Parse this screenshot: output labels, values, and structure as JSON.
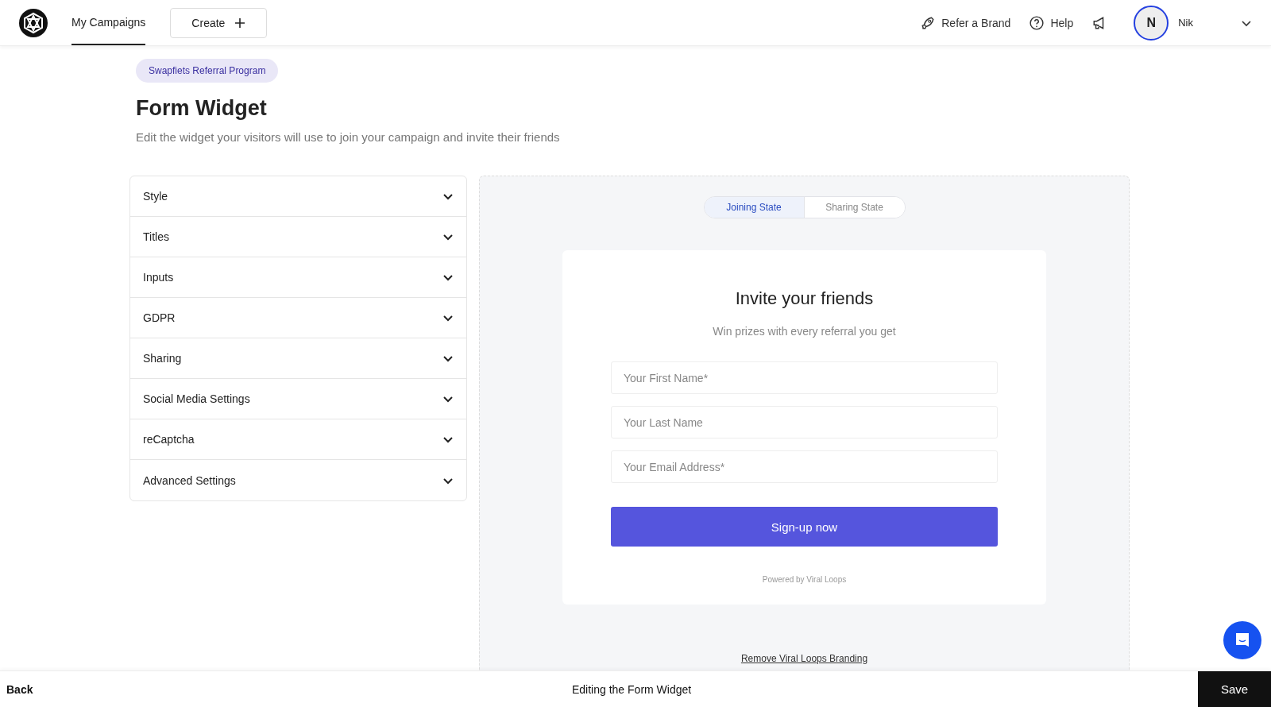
{
  "header": {
    "nav_tabs": [
      {
        "label": "My Campaigns",
        "selected": true
      }
    ],
    "create_button": "Create",
    "links": [
      {
        "kind": "refer",
        "label": "Refer a Brand"
      },
      {
        "kind": "help",
        "label": "Help"
      },
      {
        "kind": "announce"
      }
    ],
    "user": {
      "initial": "N",
      "name": "Nik"
    }
  },
  "page": {
    "campaign_tag": "Swapfiets Referral Program",
    "title": "Form Widget",
    "subtitle": "Edit the widget your visitors will use to join your campaign and invite their friends"
  },
  "sections": [
    {
      "label": "Style",
      "expanded": false
    },
    {
      "label": "Titles",
      "expanded": false
    },
    {
      "label": "Inputs",
      "expanded": false
    },
    {
      "label": "GDPR",
      "expanded": false
    },
    {
      "label": "Sharing",
      "expanded": false
    },
    {
      "label": "Social Media Settings",
      "expanded": false
    },
    {
      "label": "reCaptcha",
      "expanded": false
    },
    {
      "label": "Advanced Settings",
      "expanded": false
    }
  ],
  "preview": {
    "state_tabs": [
      {
        "label": "Joining State",
        "selected": true
      },
      {
        "label": "Sharing State",
        "selected": false
      }
    ],
    "widget": {
      "title": "Invite your friends",
      "subtitle": "Win prizes with every referral you get",
      "fields": [
        {
          "placeholder": "Your First Name*"
        },
        {
          "placeholder": "Your Last Name"
        },
        {
          "placeholder": "Your Email Address*"
        }
      ],
      "submit": "Sign-up now",
      "powered_by": "Powered by Viral Loops"
    },
    "remove_branding": "Remove Viral Loops Branding"
  },
  "footer": {
    "back": "Back",
    "status": "Editing the Form Widget",
    "save": "Save"
  }
}
